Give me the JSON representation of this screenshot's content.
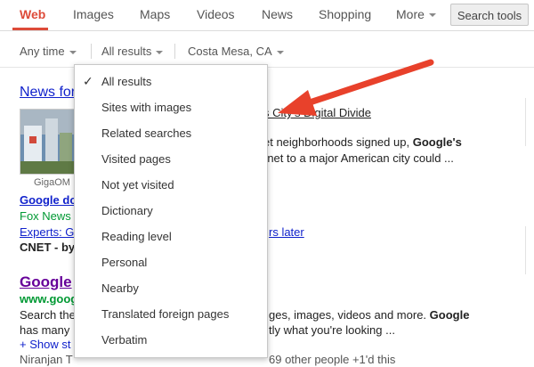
{
  "nav": {
    "tabs": [
      {
        "label": "Web",
        "active": true
      },
      {
        "label": "Images"
      },
      {
        "label": "Maps"
      },
      {
        "label": "Videos"
      },
      {
        "label": "News"
      },
      {
        "label": "Shopping"
      },
      {
        "label": "More"
      }
    ],
    "search_tools_label": "Search tools",
    "accent_color": "#dd4b39"
  },
  "tools": {
    "time": "Any time",
    "results": "All results",
    "location": "Costa Mesa, CA"
  },
  "dropdown": {
    "items": [
      {
        "label": "All results",
        "selected": true
      },
      {
        "label": "Sites with images"
      },
      {
        "label": "Related searches"
      },
      {
        "label": "Visited pages"
      },
      {
        "label": "Not yet visited"
      },
      {
        "label": "Dictionary"
      },
      {
        "label": "Reading level"
      },
      {
        "label": "Personal"
      },
      {
        "label": "Nearby"
      },
      {
        "label": "Translated foreign pages"
      },
      {
        "label": "Verbatim"
      }
    ]
  },
  "results": {
    "news_heading": "News for",
    "news_link_tail": "s City's Digital Divide",
    "news_snippet_1": "et neighborhoods signed up,",
    "news_snippet_1_bold": "Google's",
    "news_snippet_2": "rnet to a major American city could ...",
    "thumb_caption": "GigaOM",
    "sub1_link": "Google do",
    "sub1_source": "Fox News",
    "sub2_link": "Experts: G",
    "sub2_link_tail": "rs later",
    "sub2_source": "CNET - by",
    "main_title": "Google",
    "main_url": "www.goog",
    "main_snip1_head": "Search the",
    "main_snip1_tail": "ges, images, videos and more.",
    "main_snip1_bold": "Google",
    "main_snip2_head": "has many",
    "main_snip2_tail": "tly what you're looking ...",
    "show_more": "+ Show st",
    "author_head": "Niranjan T",
    "author_tail": "69 other people +1'd this"
  },
  "annotation": {
    "arrow_color": "#e8412b",
    "arrow_icon": "red-arrow-icon"
  }
}
